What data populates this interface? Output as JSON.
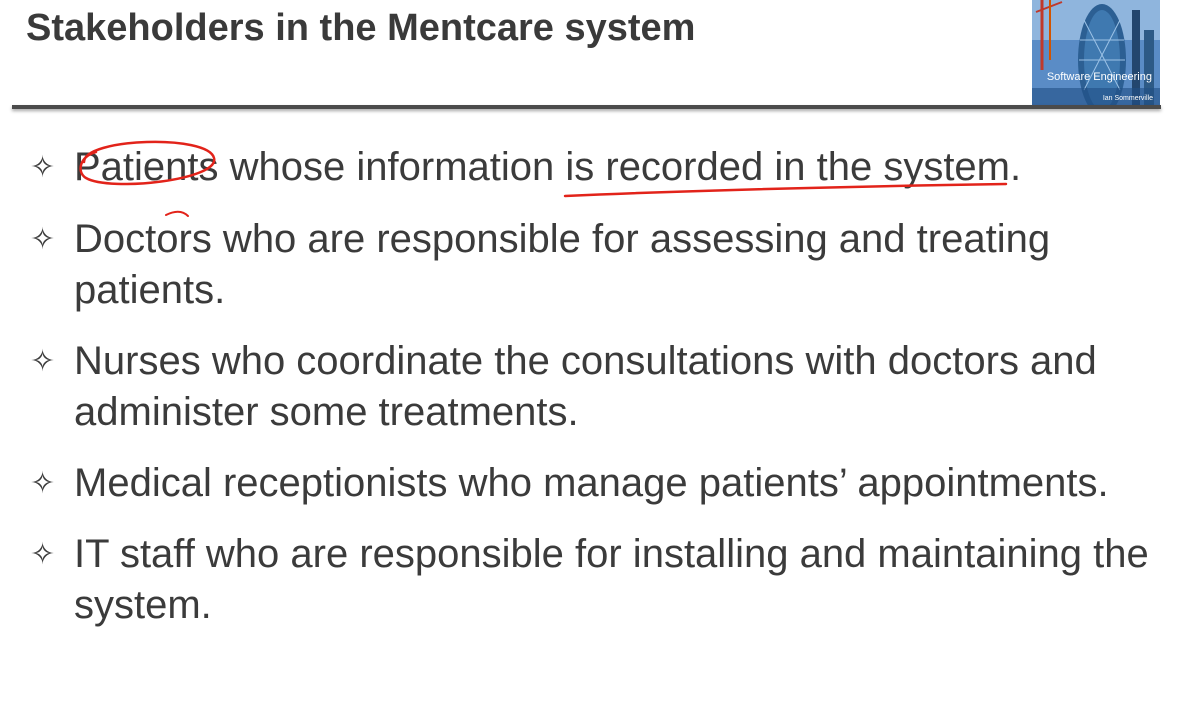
{
  "slide": {
    "title": "Stakeholders in the Mentcare system"
  },
  "book_cover": {
    "title": "Software Engineering",
    "author": "Ian Sommerville"
  },
  "bullets": [
    {
      "text": "Patients whose information is recorded in the system."
    },
    {
      "text": "Doctors who are responsible for assessing and treating patients."
    },
    {
      "text": "Nurses who coordinate the consultations with doctors and administer some treatments."
    },
    {
      "text": "Medical receptionists who manage patients’ appointments."
    },
    {
      "text": "IT staff who are responsible for installing and maintaining the system."
    }
  ],
  "icons": {
    "bullet": "diamond-star-icon"
  },
  "colors": {
    "text": "#3b3b3b",
    "rule": "#4b4b4b",
    "annotation": "#e2231a",
    "cover": "#3b74b6"
  }
}
